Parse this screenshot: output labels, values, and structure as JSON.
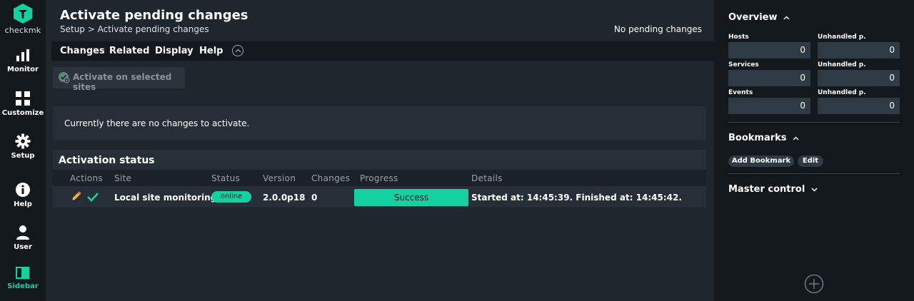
{
  "app": {
    "logo_text": "checkmk"
  },
  "nav": {
    "monitor": "Monitor",
    "customize": "Customize",
    "setup": "Setup",
    "help": "Help",
    "user": "User",
    "sidebar": "Sidebar"
  },
  "page": {
    "title": "Activate pending changes",
    "breadcrumb": "Setup > Activate pending changes",
    "pending_note": "No pending changes"
  },
  "menu": {
    "items": [
      "Changes",
      "Related",
      "Display",
      "Help"
    ]
  },
  "toolbar": {
    "activate_label": "Activate on selected sites"
  },
  "info": {
    "message": "Currently there are no changes to activate."
  },
  "activation_status": {
    "title": "Activation status",
    "columns": [
      "Actions",
      "Site",
      "Status",
      "Version",
      "Changes",
      "Progress",
      "Details"
    ],
    "rows": [
      {
        "site": "Local site monitoring",
        "status": "online",
        "version": "2.0.0p18",
        "changes": "0",
        "progress_label": "Success",
        "progress_fraction": 1.0,
        "details": "Started at: 14:45:39. Finished at: 14:45:42."
      }
    ]
  },
  "sidebar": {
    "overview": {
      "title": "Overview",
      "hosts_label": "Hosts",
      "hosts_value": "0",
      "hosts_unhandled_label": "Unhandled p.",
      "hosts_unhandled_value": "0",
      "services_label": "Services",
      "services_value": "0",
      "services_unhandled_label": "Unhandled p.",
      "services_unhandled_value": "0",
      "events_label": "Events",
      "events_value": "0",
      "events_unhandled_label": "Unhandled p.",
      "events_unhandled_value": "0"
    },
    "bookmarks": {
      "title": "Bookmarks",
      "add_label": "Add Bookmark",
      "edit_label": "Edit"
    },
    "master_control": {
      "title": "Master control"
    }
  },
  "colors": {
    "accent": "#15d1a0",
    "background": "#1e262e",
    "nav_background": "#13181d",
    "panel": "#262f38"
  }
}
